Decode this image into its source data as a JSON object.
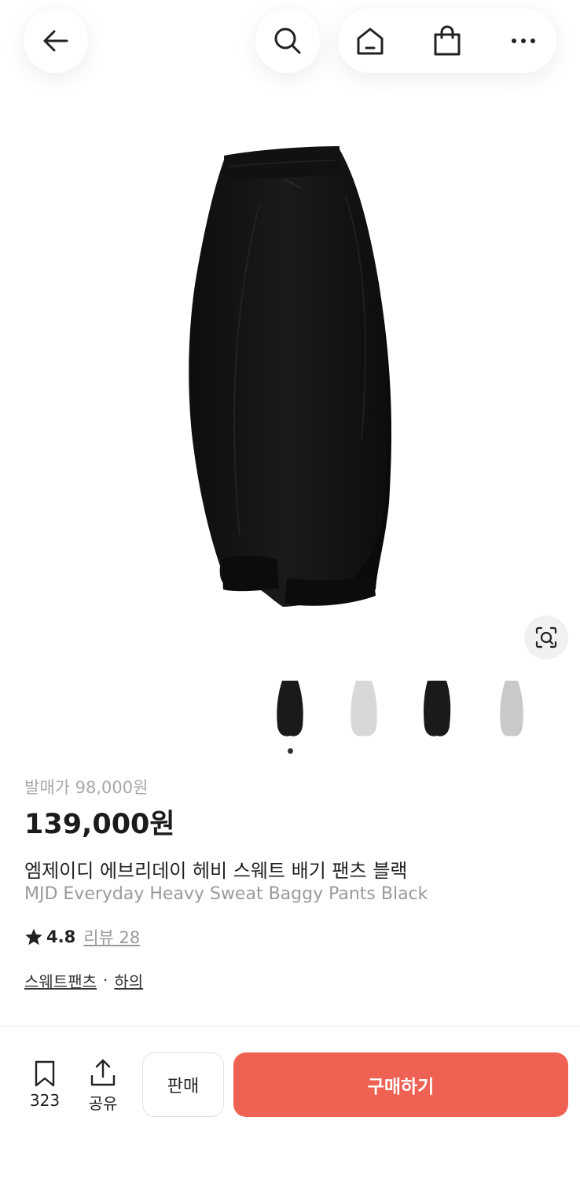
{
  "header": {
    "back_icon": "arrow-left-icon",
    "search_icon": "search-icon",
    "home_icon": "home-icon",
    "cart_icon": "shopping-bag-icon",
    "more_icon": "more-icon"
  },
  "gallery": {
    "main_image": "black-sweatpants",
    "lens_icon": "image-search-icon",
    "thumbnails": [
      {
        "color": "#1a1a1a",
        "name": "black"
      },
      {
        "color": "#d8d8d8",
        "name": "light-gray"
      },
      {
        "color": "#1a1a1a",
        "name": "black"
      },
      {
        "color": "#c9c9c9",
        "name": "gray"
      }
    ],
    "active_index": 0
  },
  "product": {
    "release_price": "발매가 98,000원",
    "price": "139,000원",
    "name_ko": "엠제이디 에브리데이 헤비 스웨트 배기 팬츠 블랙",
    "name_en": "MJD Everyday Heavy Sweat Baggy Pants Black",
    "rating": "4.8",
    "reviews": "리뷰 28",
    "category_1": "스웨트팬츠",
    "category_sep": "·",
    "category_2": "하의"
  },
  "bottom_bar": {
    "bookmark_count": "323",
    "share_label": "공유",
    "sell_label": "판매",
    "buy_label": "구매하기",
    "buy_color": "#ef6253"
  }
}
